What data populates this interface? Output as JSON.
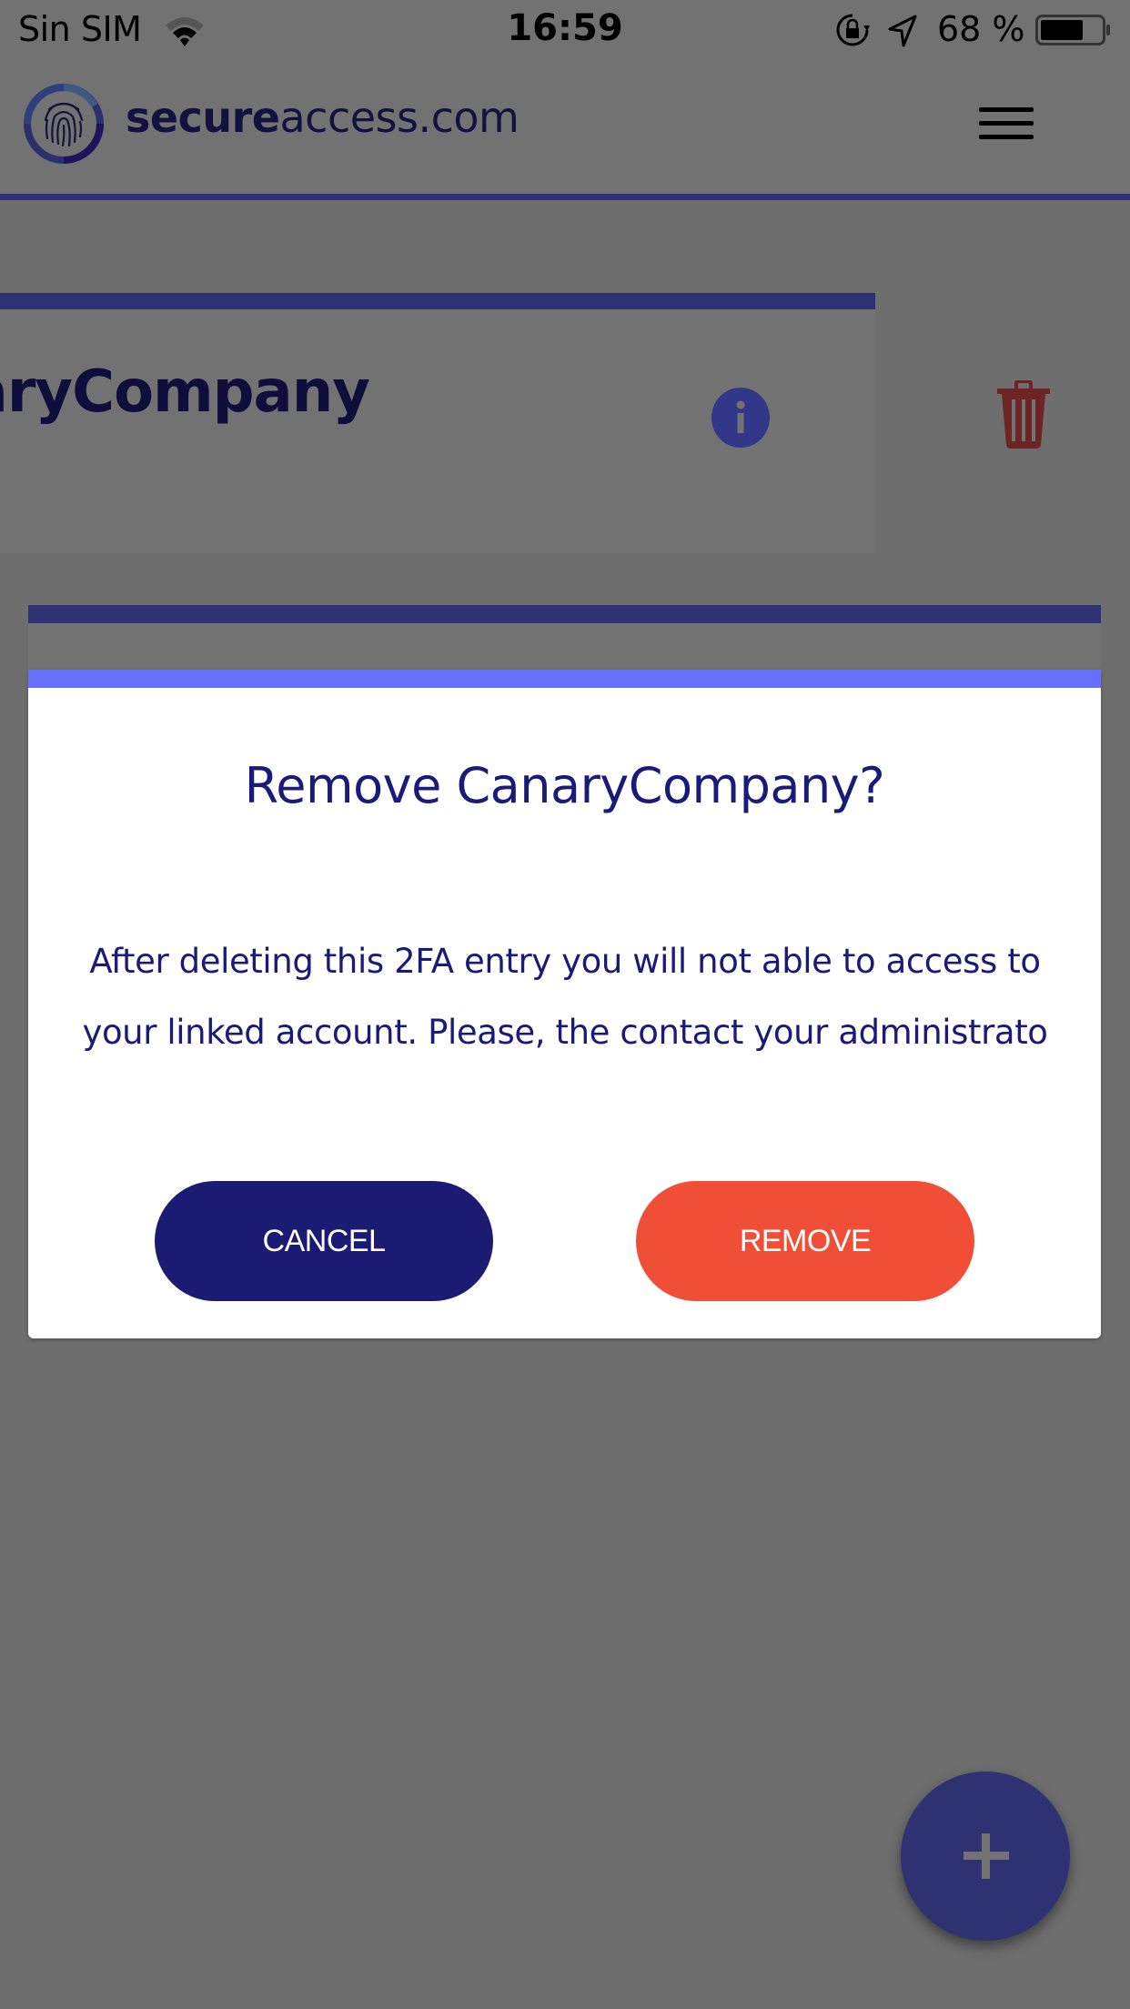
{
  "status_bar": {
    "carrier": "Sin SIM",
    "time": "16:59",
    "battery_percent": "68 %",
    "icons": [
      "wifi-icon",
      "orientation-lock-icon",
      "location-arrow-icon",
      "battery-icon"
    ]
  },
  "header": {
    "logo_text_bold": "secure",
    "logo_text_regular": "access.com",
    "menu_icon": "hamburger-menu-icon"
  },
  "entry": {
    "name_visible": "aryCompany",
    "info_icon": "info-icon",
    "delete_icon": "trash-icon"
  },
  "dialog": {
    "title": "Remove CanaryCompany?",
    "body_line1": "After deleting this 2FA entry you will not able to access to",
    "body_line2": "your linked account. Please, the contact your administrato",
    "cancel_label": "CANCEL",
    "remove_label": "REMOVE"
  },
  "fab": {
    "icon": "plus-icon"
  },
  "colors": {
    "brand_navy": "#1b1b74",
    "accent_blue": "#6672ff",
    "danger": "#f04e37",
    "overlay_gray": "#6e6e6e"
  }
}
